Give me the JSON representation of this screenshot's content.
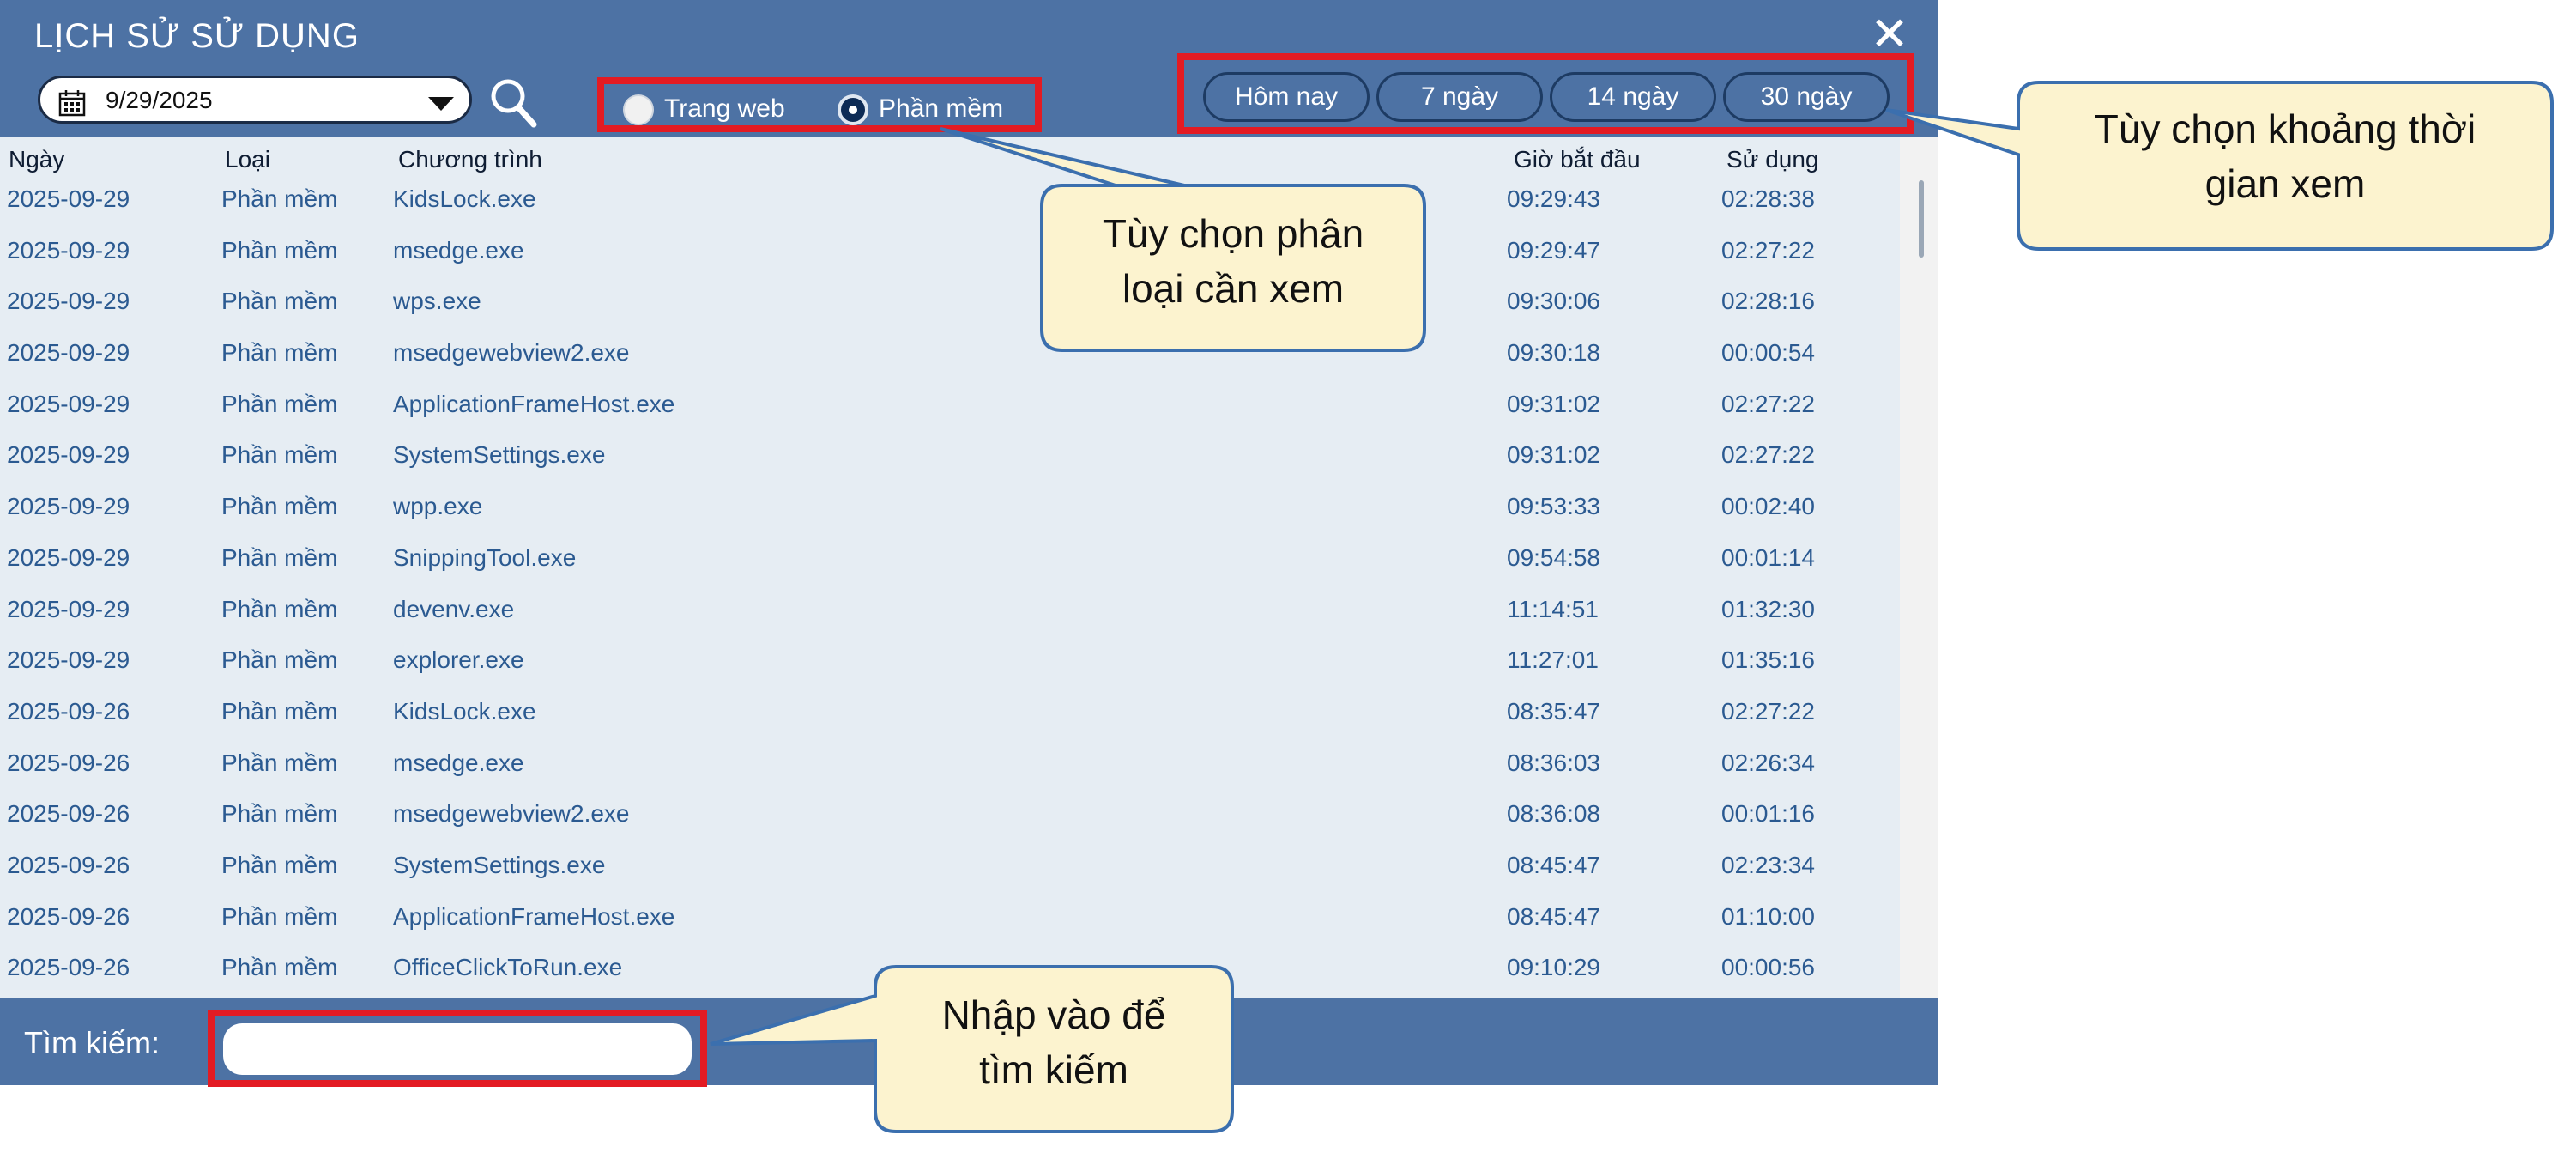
{
  "window": {
    "title": "LỊCH SỬ SỬ DỤNG",
    "close_icon": "close-icon"
  },
  "toolbar": {
    "date_value": "9/29/2025",
    "type_options": [
      {
        "label": "Trang web",
        "selected": false
      },
      {
        "label": "Phần mềm",
        "selected": true
      }
    ],
    "range_buttons": [
      "Hôm nay",
      "7 ngày",
      "14  ngày",
      "30  ngày"
    ]
  },
  "table": {
    "columns": [
      "Ngày",
      "Loại",
      "Chương trình",
      "Giờ bắt đầu",
      "Sử dụng"
    ],
    "rows": [
      [
        "2025-09-29",
        "Phần mềm",
        "KidsLock.exe",
        "09:29:43",
        "02:28:38"
      ],
      [
        "2025-09-29",
        "Phần mềm",
        "msedge.exe",
        "09:29:47",
        "02:27:22"
      ],
      [
        "2025-09-29",
        "Phần mềm",
        "wps.exe",
        "09:30:06",
        "02:28:16"
      ],
      [
        "2025-09-29",
        "Phần mềm",
        "msedgewebview2.exe",
        "09:30:18",
        "00:00:54"
      ],
      [
        "2025-09-29",
        "Phần mềm",
        "ApplicationFrameHost.exe",
        "09:31:02",
        "02:27:22"
      ],
      [
        "2025-09-29",
        "Phần mềm",
        "SystemSettings.exe",
        "09:31:02",
        "02:27:22"
      ],
      [
        "2025-09-29",
        "Phần mềm",
        "wpp.exe",
        "09:53:33",
        "00:02:40"
      ],
      [
        "2025-09-29",
        "Phần mềm",
        "SnippingTool.exe",
        "09:54:58",
        "00:01:14"
      ],
      [
        "2025-09-29",
        "Phần mềm",
        "devenv.exe",
        "11:14:51",
        "01:32:30"
      ],
      [
        "2025-09-29",
        "Phần mềm",
        "explorer.exe",
        "11:27:01",
        "01:35:16"
      ],
      [
        "2025-09-26",
        "Phần mềm",
        "KidsLock.exe",
        "08:35:47",
        "02:27:22"
      ],
      [
        "2025-09-26",
        "Phần mềm",
        "msedge.exe",
        "08:36:03",
        "02:26:34"
      ],
      [
        "2025-09-26",
        "Phần mềm",
        "msedgewebview2.exe",
        "08:36:08",
        "00:01:16"
      ],
      [
        "2025-09-26",
        "Phần mềm",
        "SystemSettings.exe",
        "08:45:47",
        "02:23:34"
      ],
      [
        "2025-09-26",
        "Phần mềm",
        "ApplicationFrameHost.exe",
        "08:45:47",
        "01:10:00"
      ],
      [
        "2025-09-26",
        "Phần mềm",
        "OfficeClickToRun.exe",
        "09:10:29",
        "00:00:56"
      ]
    ]
  },
  "footer": {
    "search_label": "Tìm kiếm:",
    "search_value": ""
  },
  "callouts": {
    "type_filter": [
      "Tùy chọn phân",
      "loại cần xem"
    ],
    "time_range": [
      "Tùy chọn khoảng thời",
      "gian xem"
    ],
    "search": [
      "Nhập vào để",
      "tìm kiếm"
    ]
  },
  "colors": {
    "header_bg": "#4d72a4",
    "list_bg": "#e6edf3",
    "row_text": "#2b5a91",
    "highlight": "#e31b23",
    "callout_fill": "#fcf3cf",
    "callout_border": "#3b6fae"
  }
}
